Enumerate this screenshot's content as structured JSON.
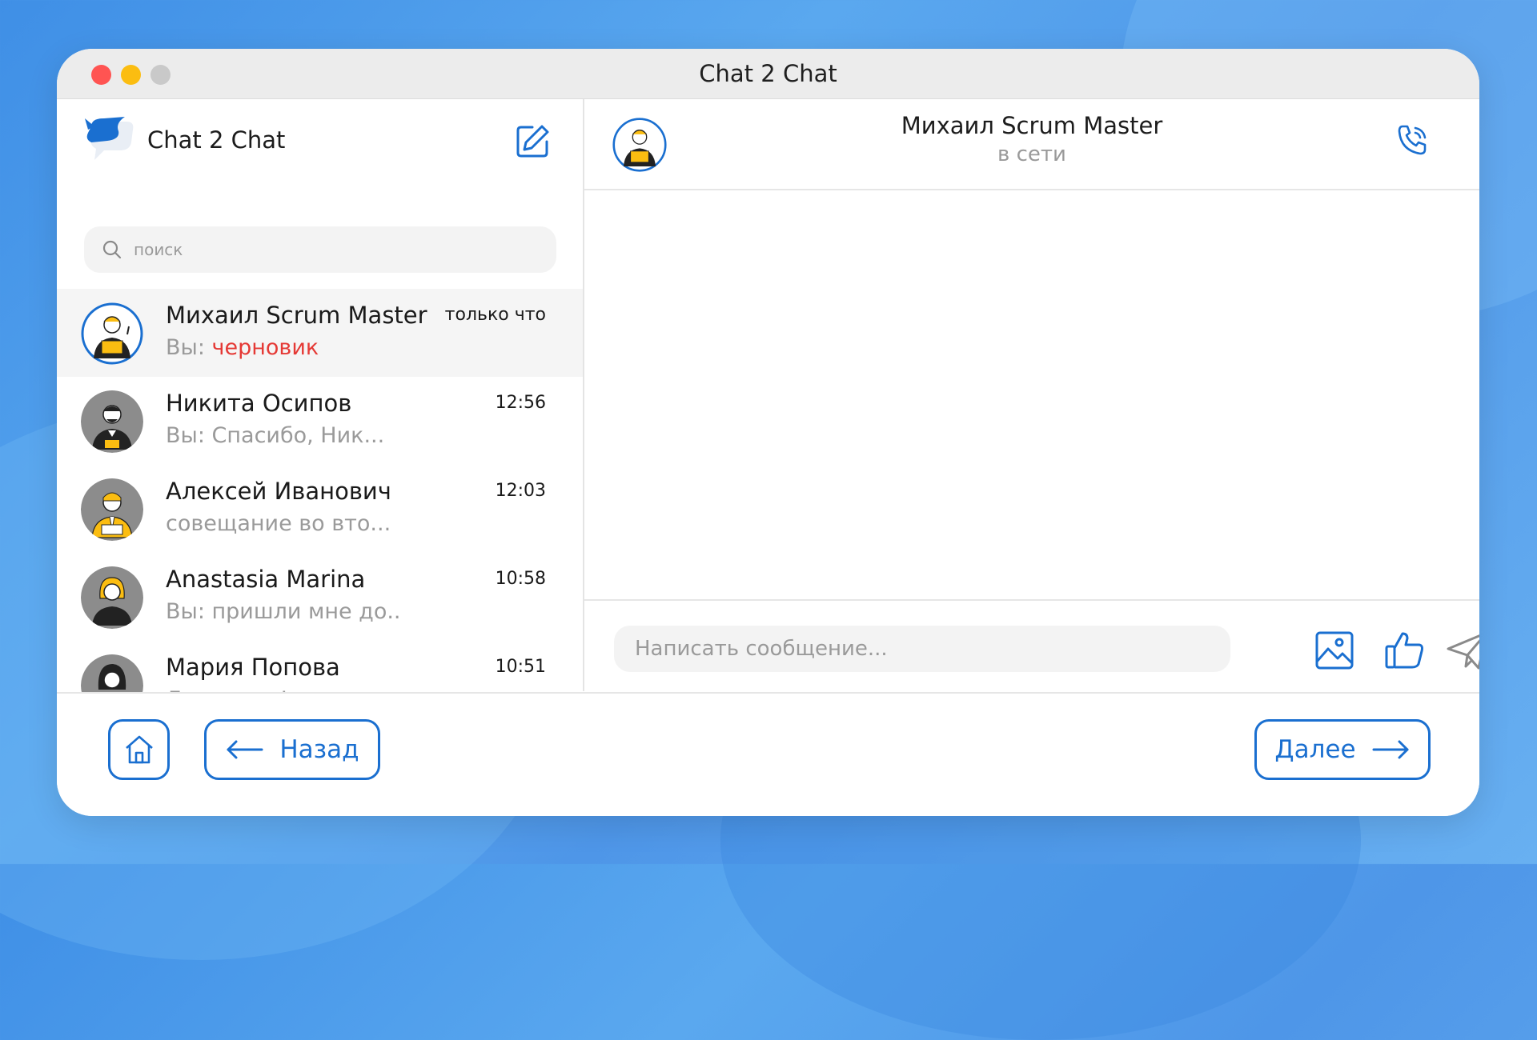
{
  "window": {
    "title": "Chat 2 Chat"
  },
  "sidebar": {
    "app_name": "Chat 2 Chat",
    "search_placeholder": "поиск",
    "chats": [
      {
        "name": "Михаил Scrum Master",
        "preview_prefix": "Вы: ",
        "preview": "черновик",
        "time": "только что",
        "active": true
      },
      {
        "name": "Никита Осипов",
        "preview_prefix": "",
        "preview": "Вы: Спасибо, Ник...",
        "time": "12:56"
      },
      {
        "name": "Алексей Иванович",
        "preview_prefix": "",
        "preview": "совещание во вто...",
        "time": "12:03"
      },
      {
        "name": "Anastasia Marina",
        "preview_prefix": "",
        "preview": "Вы: пришли мне до..",
        "time": "10:58"
      },
      {
        "name": "Мария Попова",
        "preview_prefix": "",
        "preview": "До завтра!",
        "time": "10:51"
      }
    ]
  },
  "chat": {
    "contact_name": "Михаил Scrum Master",
    "status": "в сети",
    "input_placeholder": "Написать сообщение..."
  },
  "nav": {
    "back_label": "Назад",
    "next_label": "Далее"
  },
  "colors": {
    "accent": "#1a6fd0",
    "draft": "#e53935",
    "highlight": "#fbbd11"
  }
}
